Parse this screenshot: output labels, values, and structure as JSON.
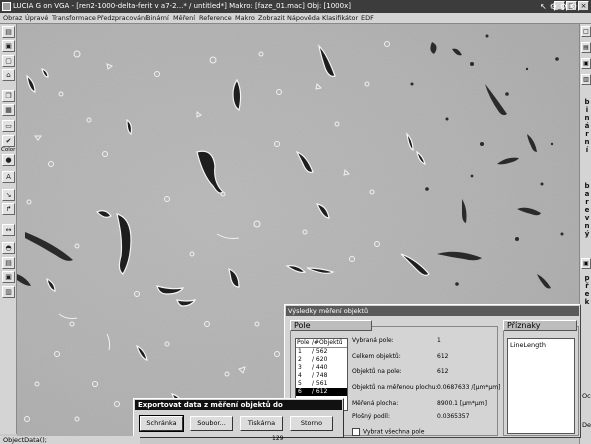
{
  "titlebar": {
    "title": "LUCIA  G on VGA - [ren2-1000-delta-ferit v a7-2...* / untitled*]  Makro: [faze_01.mac]  Obj: [1000x]",
    "buttons": [
      "_",
      "□",
      "×"
    ]
  },
  "menu": {
    "items": [
      "Obraz",
      "Úpravé",
      "Transformace",
      "Předzpracování",
      "Binární",
      "Měření",
      "Reference",
      "Makro",
      "Zobrazit",
      "Nápověda",
      "Klasifikátor",
      "EDF"
    ]
  },
  "left_toolbar": {
    "buttons": [
      "▤",
      "▣",
      "▢",
      "⌂",
      "❐",
      "▦",
      "▭",
      "✔",
      "●",
      "A",
      "↘",
      "↱",
      "↔",
      "◓",
      "▤",
      "▣",
      "▥"
    ],
    "color_label": "Color"
  },
  "right_toolbar": {
    "vertical_labels": [
      "binární",
      "barevný",
      "přek"
    ]
  },
  "results": {
    "title": "Výsledky měření objektů",
    "group_left_label": "Pole",
    "group_right_label": "Příznaky",
    "list_headers": [
      "Pole",
      "/#Objektů"
    ],
    "rows": [
      {
        "pole": "1",
        "count": "/ 562"
      },
      {
        "pole": "2",
        "count": "/ 620"
      },
      {
        "pole": "3",
        "count": "/ 440"
      },
      {
        "pole": "4",
        "count": "/ 748"
      },
      {
        "pole": "5",
        "count": "/ 561"
      },
      {
        "pole": "6",
        "count": "/ 612"
      }
    ],
    "selected_row": 5,
    "stats": [
      {
        "label": "Vybraná pole:",
        "value": "1"
      },
      {
        "label": "Celkem objektů:",
        "value": "612"
      },
      {
        "label": "Objektů na pole:",
        "value": "612"
      },
      {
        "label": "Objektů na měřenou plochu:",
        "value": "0.0687633 /[μm*μm]"
      },
      {
        "label": "Měřená plocha:",
        "value": "8900.1 [μm*μm]"
      },
      {
        "label": "Plošný podíl:",
        "value": "0.0365357"
      }
    ],
    "checkbox_label": "Vybrat všechna pole",
    "features": [
      "LineLength"
    ]
  },
  "export_dialog": {
    "title": "Exportovat data z měření objektů do",
    "buttons": [
      "Schránka",
      "Soubor...",
      "Tiskárna",
      "Storno"
    ]
  },
  "side_labels": {
    "oc": "Oc",
    "de": "De"
  },
  "status": {
    "text": "ObjectData();",
    "bottom_number": "129"
  }
}
